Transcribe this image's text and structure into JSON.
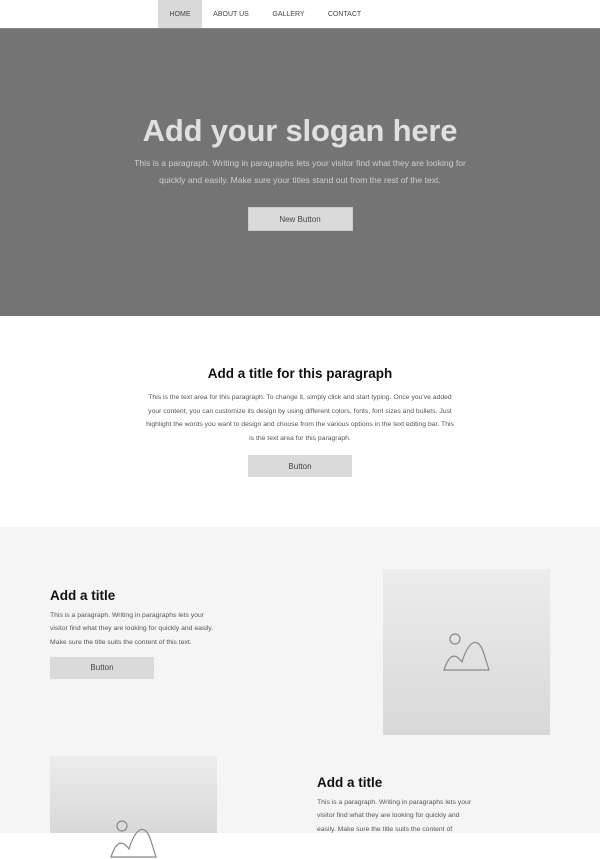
{
  "nav": {
    "items": [
      {
        "label": "HOME",
        "active": true
      },
      {
        "label": "ABOUT US"
      },
      {
        "label": "GALLERY"
      },
      {
        "label": "CONTACT"
      }
    ]
  },
  "hero": {
    "title": "Add your slogan here",
    "paragraph": "This is a paragraph. Writing in paragraphs lets your visitor find what they are looking for quickly and easily. Make sure your titles stand out from the rest of the text.",
    "button": "New Button"
  },
  "section2": {
    "title": "Add a title for this paragraph",
    "paragraph": "This is the text area for this paragraph. To change it, simply click and start typing. Once you've added your content, you can customize its design by using different colors, fonts, font sizes and bullets. Just highlight the words you want to design and choose from the various options in the text editing bar. This is the text area for this paragraph.",
    "button": "Button"
  },
  "feature1": {
    "title": "Add a title",
    "paragraph": "This is a paragraph. Writing in paragraphs lets your visitor find what they are looking for quickly and easily. Make sure the title suits the content of this text.",
    "button": "Button",
    "image_icon": "image-placeholder-icon"
  },
  "feature2": {
    "title": "Add a title",
    "paragraph": "This is a paragraph. Writing in paragraphs lets your visitor find what they are looking for quickly and easily. Make sure the title suits the content of",
    "image_icon": "image-placeholder-icon"
  }
}
